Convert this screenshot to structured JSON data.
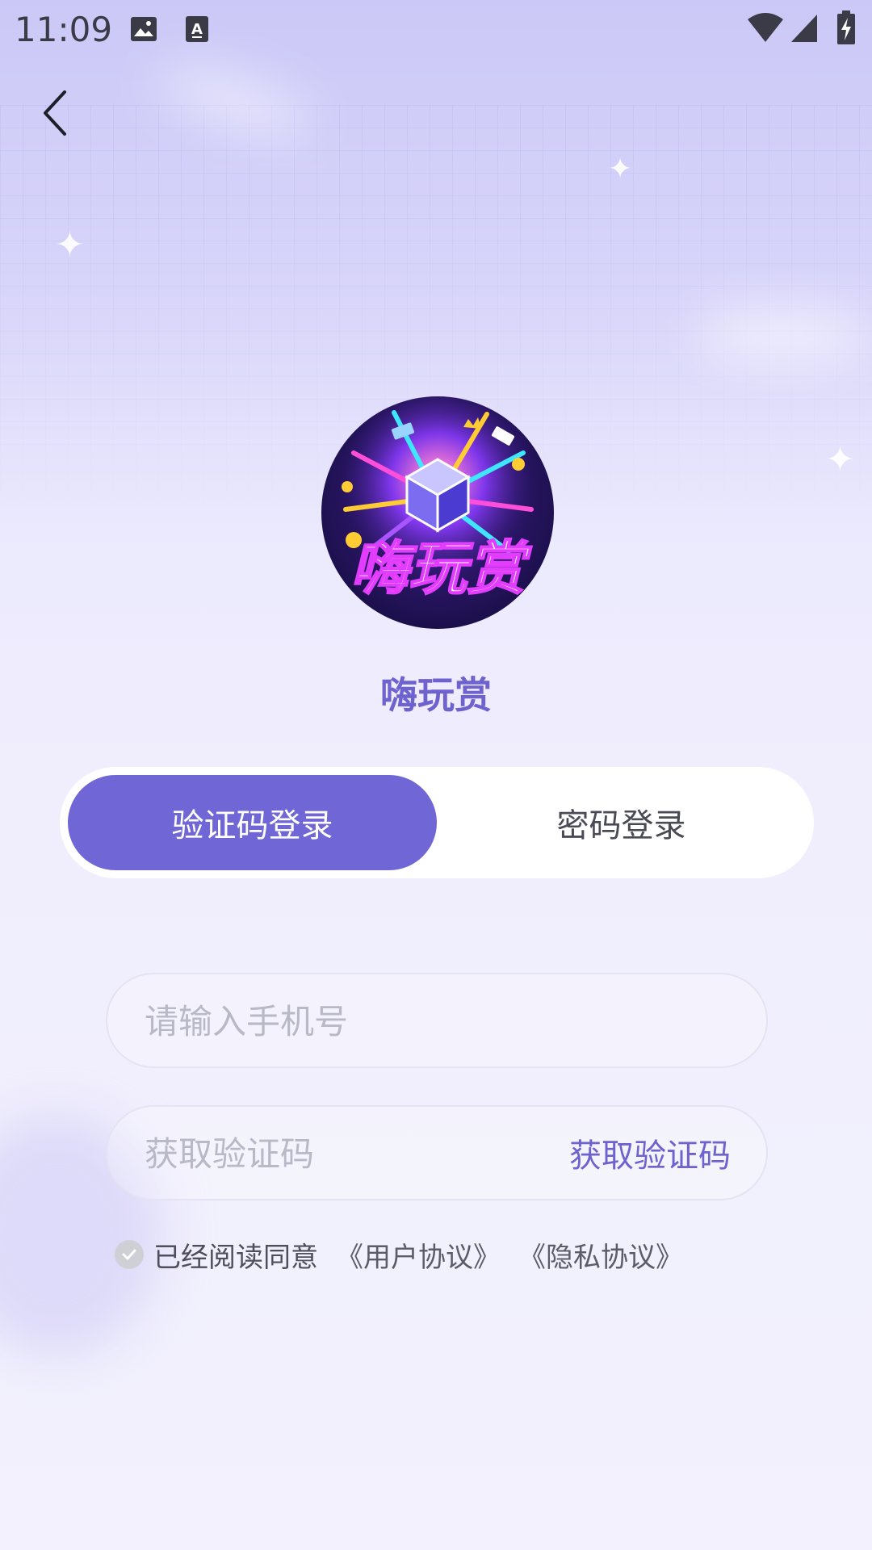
{
  "status_bar": {
    "time": "11:09",
    "icons": [
      "image-icon",
      "text-input-icon",
      "wifi-icon",
      "signal-icon",
      "battery-charging-icon"
    ]
  },
  "header": {
    "back_icon": "chevron-left-icon"
  },
  "app": {
    "name": "嗨玩赏",
    "logo_text": "嗨玩赏"
  },
  "tabs": [
    {
      "label": "验证码登录",
      "active": true
    },
    {
      "label": "密码登录",
      "active": false
    }
  ],
  "form": {
    "phone_placeholder": "请输入手机号",
    "code_placeholder": "获取验证码",
    "get_code_label": "获取验证码"
  },
  "agreement": {
    "prefix": "已经阅读同意",
    "user_agreement": "《用户协议》",
    "privacy_policy": "《隐私协议》"
  },
  "colors": {
    "accent": "#7066d6",
    "brand_text": "#6e62cf",
    "background_top": "#cbc8f7",
    "background_bottom": "#f2f1fd"
  }
}
